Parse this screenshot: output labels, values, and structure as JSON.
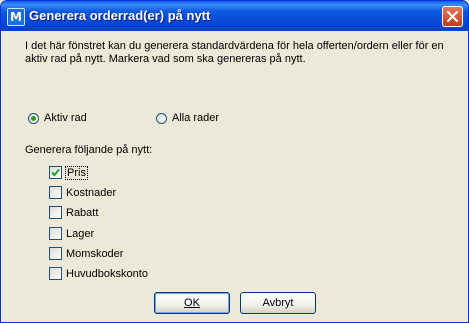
{
  "window": {
    "title": "Generera orderrad(er) på nytt",
    "app_icon_letter": "M",
    "description": "I det här fönstret kan du generera standardvärdena för hela offerten/ordern eller för en aktiv rad på nytt. Markera vad som ska genereras på nytt."
  },
  "scope": {
    "active_row_label": "Aktiv rad",
    "all_rows_label": "Alla rader",
    "selected": "active_row"
  },
  "regenerate": {
    "label": "Generera följande på nytt:",
    "options": [
      {
        "label": "Pris",
        "checked": true
      },
      {
        "label": "Kostnader",
        "checked": false
      },
      {
        "label": "Rabatt",
        "checked": false
      },
      {
        "label": "Lager",
        "checked": false
      },
      {
        "label": "Momskoder",
        "checked": false
      },
      {
        "label": "Huvudbokskonto",
        "checked": false
      }
    ]
  },
  "buttons": {
    "ok_label": "OK",
    "cancel_label": "Avbryt"
  }
}
